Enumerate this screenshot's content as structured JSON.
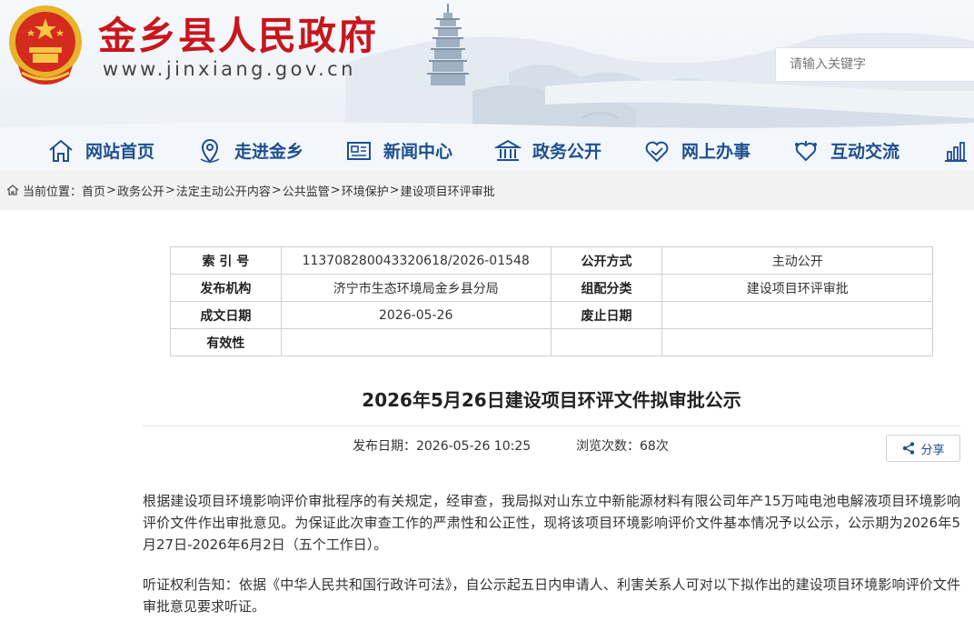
{
  "site": {
    "title": "金乡县人民政府",
    "url": "www.jinxiang.gov.cn",
    "brand_color": "#c8161d"
  },
  "search": {
    "placeholder": "请输入关键字"
  },
  "nav": {
    "items": [
      {
        "label": "网站首页",
        "icon": "home-icon"
      },
      {
        "label": "走进金乡",
        "icon": "map-pin-icon"
      },
      {
        "label": "新闻中心",
        "icon": "newspaper-icon"
      },
      {
        "label": "政务公开",
        "icon": "government-building-icon"
      },
      {
        "label": "网上办事",
        "icon": "handshake-icon"
      },
      {
        "label": "互动交流",
        "icon": "interaction-icon"
      },
      {
        "label": "",
        "icon": "chart-icon"
      }
    ],
    "color": "#1d4f91"
  },
  "breadcrumb": {
    "prefix": "当前位置：",
    "items": [
      "首页",
      "政务公开",
      "法定主动公开内容",
      "公共监管",
      "环境保护",
      "建设项目环评审批"
    ]
  },
  "meta": {
    "index_label": "索 引 号",
    "index_value": "11370828004332061​8/2026-01548",
    "disclosure_label": "公开方式",
    "disclosure_value": "主动公开",
    "publisher_label": "发布机构",
    "publisher_value": "济宁市生态环境局金乡县分局",
    "category_label": "组配分类",
    "category_value": "建设项目环评审批",
    "written_date_label": "成文日期",
    "written_date_value": "2026-05-26",
    "expiry_label": "废止日期",
    "expiry_value": "",
    "validity_label": "有效性",
    "validity_value": ""
  },
  "article": {
    "title": "2026年5月26日建设项目环评文件拟审批公示",
    "publish_label": "发布日期：",
    "publish_value": "2026-05-26 10:25",
    "views_label": "浏览次数：",
    "views_value": "68次",
    "share_label": "分享",
    "paragraphs": [
      "根据建设项目环境影响评价审批程序的有关规定，经审查，我局拟对山东立中新能源材料有限公司年产15万吨电池电解液项目环境影响评价文件作出审批意见。为保证此次审查工作的严肃性和公正性，现将该项目环境影响评价文件基本情况予以公示，公示期为2026年5月27日-2026年6月2日（五个工作日）。",
      "听证权利告知：依据《中华人民共和国行政许可法》，自公示起五日内申请人、利害关系人可对以下拟作出的建设项目环境影响评价文件审批意见要求听证。"
    ]
  }
}
